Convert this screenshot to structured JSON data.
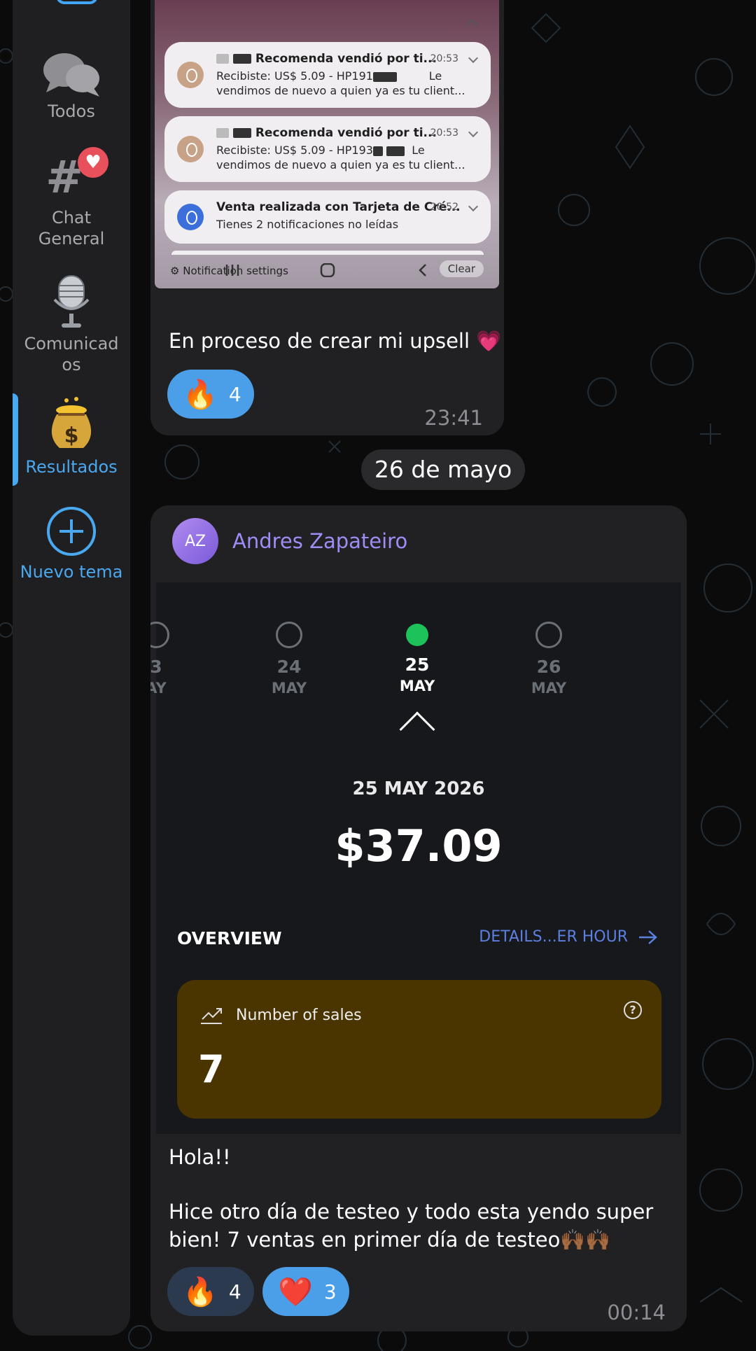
{
  "sidebar": {
    "items": [
      {
        "label": "Todos",
        "icon": "chat-bubbles-icon"
      },
      {
        "label": "Chat\nGeneral",
        "icon": "hashtag-icon",
        "badge": "heart"
      },
      {
        "label": "Comunicad\nos",
        "icon": "microphone-icon"
      },
      {
        "label": "Resultados",
        "icon": "money-bag-icon",
        "active": true
      },
      {
        "label": "Nuevo tema",
        "icon": "plus-circle-icon"
      }
    ]
  },
  "message1": {
    "screenshot": {
      "notifications": [
        {
          "title": "Recomenda vendió por ti...",
          "time": "20:53",
          "body": "Recibiste: US$ 5.09 - HP191",
          "body2": "Le",
          "body3": "vendimos de nuevo a quien ya es tu client..."
        },
        {
          "title": "Recomenda vendió por ti...",
          "time": "20:53",
          "body": "Recibiste: US$ 5.09 - HP193",
          "body2": "Le",
          "body3": "vendimos de nuevo a quien ya es tu client..."
        },
        {
          "title": "Venta realizada con Tarjeta de Cré...",
          "time": "20:52",
          "body": "Tienes 2 notificaciones no leídas"
        }
      ],
      "settings_label": "Notification settings",
      "clear_label": "Clear"
    },
    "text": "En proceso de crear mi upsell 💗",
    "reaction": {
      "emoji": "🔥",
      "count": "4"
    },
    "time": "23:41"
  },
  "date_separator": "26 de mayo",
  "message2": {
    "sender": {
      "initials": "AZ",
      "name": "Andres Zapateiro"
    },
    "screenshot": {
      "days": [
        {
          "num": "3",
          "mon": "AY"
        },
        {
          "num": "24",
          "mon": "MAY"
        },
        {
          "num": "25",
          "mon": "MAY",
          "selected": true
        },
        {
          "num": "26",
          "mon": "MAY"
        }
      ],
      "date": "25 MAY 2026",
      "amount": "$37.09",
      "overview": "OVERVIEW",
      "details": "DETAILS...ER HOUR",
      "card_label": "Number of sales",
      "card_value": "7"
    },
    "text_line1": "Hola!!",
    "text_line2": "Hice otro día de testeo y todo esta yendo super",
    "text_line3": "bien! 7 ventas en primer día de testeo🙌🏾🙌🏾",
    "reactions": [
      {
        "emoji": "🔥",
        "count": "4",
        "mine": false
      },
      {
        "emoji": "❤️",
        "count": "3",
        "mine": true
      }
    ],
    "time": "00:14"
  },
  "colors": {
    "accent": "#4aa8f0",
    "sender": "#a08cf5",
    "sales_card": "#4a3500",
    "selected_day": "#1ec25a"
  }
}
